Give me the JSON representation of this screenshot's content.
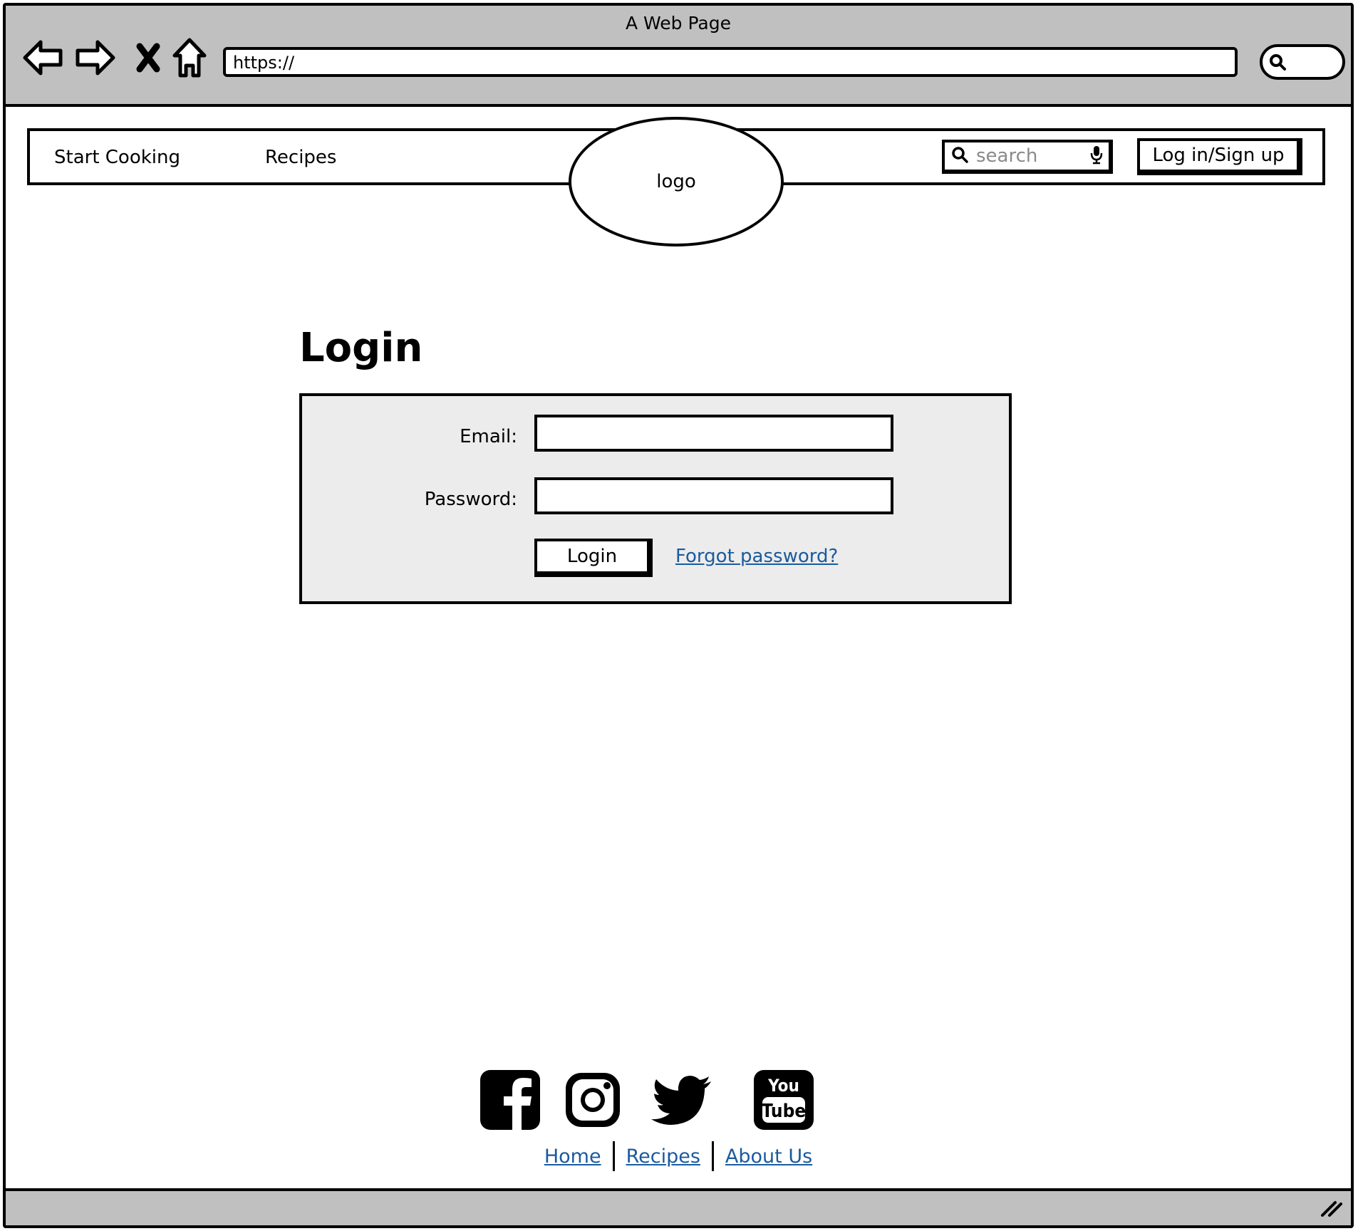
{
  "browser": {
    "title": "A Web Page",
    "url": "https://",
    "icons": [
      "back-icon",
      "forward-icon",
      "stop-icon",
      "home-icon",
      "search-icon",
      "resize-grip-icon"
    ]
  },
  "navbar": {
    "links": [
      "Start Cooking",
      "Recipes"
    ],
    "logo_text": "logo",
    "search_placeholder": "search",
    "login_signup_label": "Log in/Sign up"
  },
  "login": {
    "title": "Login",
    "email_label": "Email:",
    "email_value": "",
    "password_label": "Password:",
    "password_value": "",
    "submit_label": "Login",
    "forgot_label": "Forgot password?"
  },
  "footer": {
    "social": [
      "facebook-icon",
      "instagram-icon",
      "twitter-icon",
      "youtube-icon"
    ],
    "youtube_you": "You",
    "youtube_tube": "Tube",
    "links": [
      "Home",
      "Recipes",
      "About Us"
    ]
  },
  "colors": {
    "chrome_gray": "#c0c0c0",
    "panel_gray": "#ececec",
    "link_blue": "#1a5a9e"
  }
}
